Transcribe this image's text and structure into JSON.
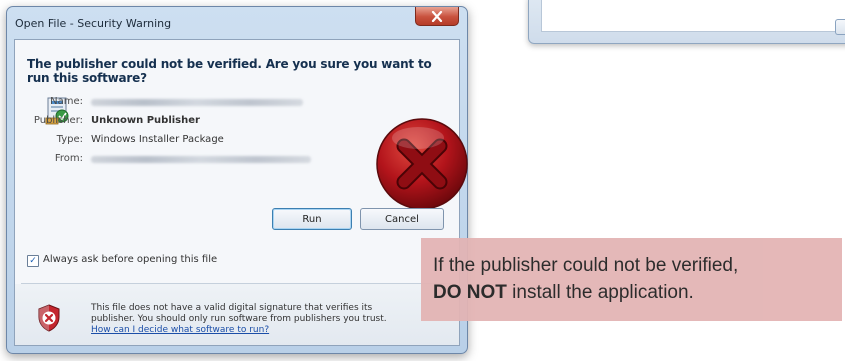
{
  "dialog": {
    "title": "Open File - Security Warning",
    "heading": "The publisher could not be verified.  Are you sure you want to run this software?",
    "fields": [
      {
        "label": "Name:",
        "value": ""
      },
      {
        "label": "Publisher:",
        "value": "Unknown Publisher"
      },
      {
        "label": "Type:",
        "value": "Windows Installer Package"
      },
      {
        "label": "From:",
        "value": ""
      }
    ],
    "run_label": "Run",
    "cancel_label": "Cancel",
    "always_ask_label": "Always ask before opening this file",
    "always_ask_checked": true,
    "warning_text": "This file does not have a valid digital signature that verifies its publisher.  You should only run software from publishers you trust.",
    "warning_link": "How can I decide what software to run?"
  },
  "callout": {
    "line1": "If the publisher could not be verified,",
    "line2_bold": "DO NOT",
    "line2_rest": " install the application."
  },
  "icons": {
    "close": "close-icon",
    "package": "installer-package-icon",
    "stop": "red-x-stop-icon",
    "shield": "security-shield-icon",
    "checkbox": "checkbox-checked-icon"
  },
  "colors": {
    "callout_bg": "#e3b4b4",
    "close_button": "#c8513d",
    "stop_icon": "#b3141b",
    "link": "#1b4ea8"
  }
}
